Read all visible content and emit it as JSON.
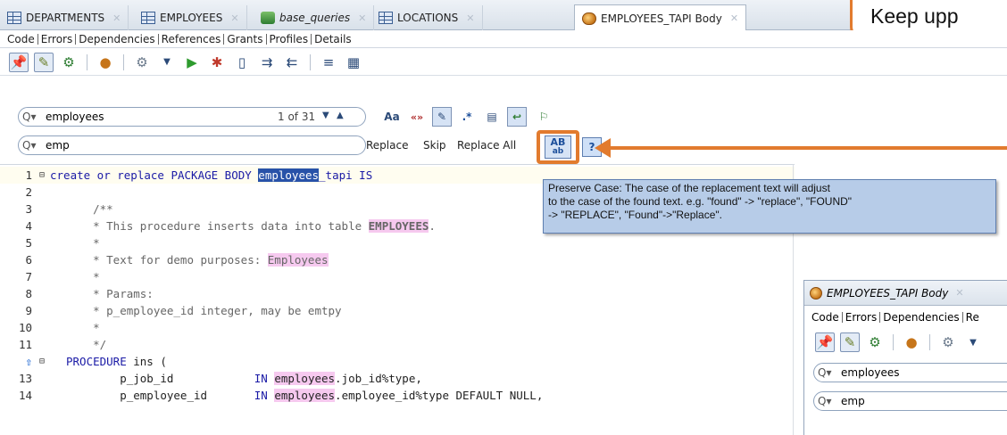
{
  "tabs": [
    {
      "label": "DEPARTMENTS",
      "icon": "table-icon",
      "italic": false
    },
    {
      "label": "EMPLOYEES",
      "icon": "table-icon",
      "italic": false
    },
    {
      "label": "base_queries",
      "icon": "sql-worksheet-icon",
      "italic": true
    },
    {
      "label": "LOCATIONS",
      "icon": "table-icon",
      "italic": false
    },
    {
      "label": "EMPLOYEES_TAPI Body",
      "icon": "package-body-icon",
      "italic": false
    }
  ],
  "callout_text": "Keep upp",
  "subtabs": [
    "Code",
    "Errors",
    "Dependencies",
    "References",
    "Grants",
    "Profiles",
    "Details"
  ],
  "toolbar_icons": [
    "pin-icon",
    "edit-icon",
    "compile-icon",
    "package-icon",
    "gear-icon",
    "dropdown-icon",
    "run-icon",
    "debug-icon",
    "bookmark-icon",
    "next-bookmark-icon",
    "prev-bookmark-icon",
    "format-icon",
    "unit-test-icon"
  ],
  "find": {
    "value": "employees",
    "count": "1 of 31",
    "options": [
      "Aa",
      "«»"
    ]
  },
  "replace": {
    "value": "emp",
    "replace_label": "Replace",
    "skip_label": "Skip",
    "replace_all_label": "Replace All",
    "preserve_case_big": "AB",
    "preserve_case_small": "ab",
    "help_glyph": "?"
  },
  "tooltip": {
    "line1": "Preserve Case: The case of the replacement text will adjust",
    "line2": "to the case of the found text. e.g. \"found\" -> \"replace\", \"FOUND\"",
    "line3": "-> \"REPLACE\", \"Found\"->\"Replace\"."
  },
  "line_numbers": [
    "1",
    "2",
    "3",
    "4",
    "5",
    "6",
    "7",
    "8",
    "9",
    "10",
    "11",
    "",
    "13",
    "14"
  ],
  "code": {
    "l1_a": "create or replace PACKAGE BODY ",
    "l1_sel": "employees",
    "l1_b": "_tapi IS",
    "l3": "    /**",
    "l4_a": "    * This procedure inserts data into table ",
    "l4_hl": "EMPLOYEES",
    "l4_b": ".",
    "l5": "    *",
    "l6_a": "    * Text for demo purposes: ",
    "l6_hl": "Employees",
    "l7": "    *",
    "l8": "    * Params:",
    "l9": "    * p_employee_id integer, may be emtpy",
    "l10": "    *",
    "l11": "    */",
    "l12_kw": "PROCEDURE",
    "l12_b": " ins (",
    "l13_a": "        p_job_id            ",
    "l13_kw": "IN",
    "l13_sp": " ",
    "l13_hl": "employees",
    "l13_b": ".job_id%type,",
    "l14_a": "        p_employee_id       ",
    "l14_kw": "IN",
    "l14_sp": " ",
    "l14_hl": "employees",
    "l14_b": ".employee_id%type DEFAULT NULL,"
  },
  "inset": {
    "tab_label": "EMPLOYEES_TAPI Body",
    "subtabs": [
      "Code",
      "Errors",
      "Dependencies",
      "Re"
    ],
    "find_value": "employees",
    "replace_value": "emp"
  },
  "colors": {
    "accent": "#e27b2e",
    "selection": "#2852a8",
    "match_highlight": "#f6c9ef",
    "tooltip_bg": "#b7cce8"
  }
}
